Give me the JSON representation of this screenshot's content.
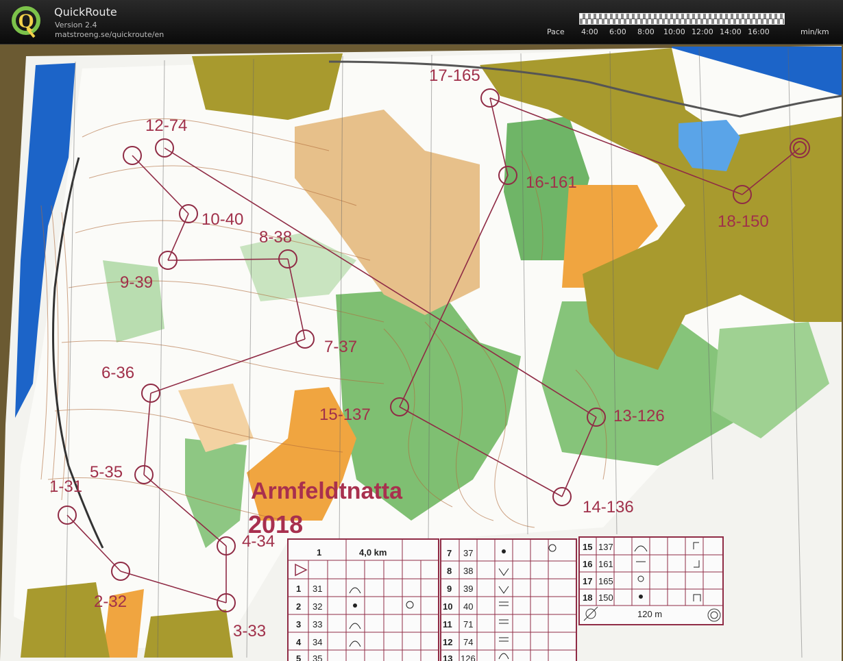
{
  "app": {
    "title": "QuickRoute",
    "version": "Version 2.4",
    "url": "matstroeng.se/quickroute/en"
  },
  "pace_legend": {
    "label": "Pace",
    "ticks": [
      "4:00",
      "6:00",
      "8:00",
      "10:00",
      "12:00",
      "14:00",
      "16:00"
    ],
    "unit": "min/km"
  },
  "map": {
    "event_title_line1": "Armfeldtnatta",
    "event_title_line2": "2018",
    "controls": [
      {
        "label": "1-31"
      },
      {
        "label": "2-32"
      },
      {
        "label": "3-33"
      },
      {
        "label": "4-34"
      },
      {
        "label": "5-35"
      },
      {
        "label": "6-36"
      },
      {
        "label": "7-37"
      },
      {
        "label": "8-38"
      },
      {
        "label": "9-39"
      },
      {
        "label": "10-40"
      },
      {
        "label": "12-74"
      },
      {
        "label": "13-126"
      },
      {
        "label": "14-136"
      },
      {
        "label": "15-137"
      },
      {
        "label": "16-161"
      },
      {
        "label": "17-165"
      },
      {
        "label": "18-150"
      }
    ],
    "description_sheet": {
      "course": "1",
      "distance": "4,0 km",
      "rows_a": [
        {
          "num": "1",
          "code": "31"
        },
        {
          "num": "2",
          "code": "32"
        },
        {
          "num": "3",
          "code": "33"
        },
        {
          "num": "4",
          "code": "34"
        },
        {
          "num": "5",
          "code": "35"
        }
      ],
      "rows_b": [
        {
          "num": "7",
          "code": "37"
        },
        {
          "num": "8",
          "code": "38"
        },
        {
          "num": "9",
          "code": "39"
        },
        {
          "num": "10",
          "code": "40"
        },
        {
          "num": "11",
          "code": "71"
        },
        {
          "num": "12",
          "code": "74"
        },
        {
          "num": "13",
          "code": "126"
        }
      ],
      "rows_c": [
        {
          "num": "15",
          "code": "137"
        },
        {
          "num": "16",
          "code": "161"
        },
        {
          "num": "17",
          "code": "165"
        },
        {
          "num": "18",
          "code": "150"
        }
      ],
      "finish_distance": "120 m"
    }
  }
}
